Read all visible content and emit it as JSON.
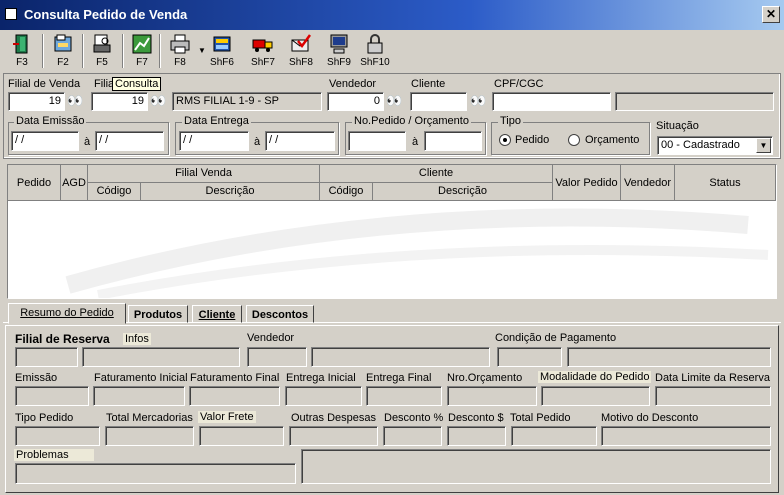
{
  "window": {
    "title": "Consulta Pedido de Venda",
    "close": "✕"
  },
  "toolbar": [
    {
      "name": "f3-exit-button",
      "label": "F3",
      "icon": "exit-icon"
    },
    {
      "name": "f2-button",
      "label": "F2",
      "icon": "folder-icon"
    },
    {
      "name": "f5-button",
      "label": "F5",
      "icon": "print-preview-icon"
    },
    {
      "name": "f7-button",
      "label": "F7",
      "icon": "chart-icon"
    },
    {
      "name": "f8-button",
      "label": "F8",
      "icon": "printer-icon"
    },
    {
      "name": "shf6-button",
      "label": "ShF6",
      "icon": "book-icon"
    },
    {
      "name": "shf7-button",
      "label": "ShF7",
      "icon": "truck-icon"
    },
    {
      "name": "shf8-button",
      "label": "ShF8",
      "icon": "check-mail-icon"
    },
    {
      "name": "shf9-button",
      "label": "ShF9",
      "icon": "monitor-icon"
    },
    {
      "name": "shf10-button",
      "label": "ShF10",
      "icon": "lock-icon"
    }
  ],
  "filter": {
    "filial_venda_label": "Filial de Venda",
    "filial_venda_value": "19",
    "filial_label": "Filia",
    "tooltip": "Consulta",
    "filial_value": "19",
    "filial_desc": "RMS FILIAL 1-9 - SP",
    "vendedor_label": "Vendedor",
    "vendedor_value": "0",
    "cliente_label": "Cliente",
    "cliente_value": "",
    "cpf_label": "CPF/CGC",
    "cpf_value": "",
    "data_emissao_label": "Data Emissão",
    "date_empty": "/ /",
    "a_label": "à",
    "data_entrega_label": "Data Entrega",
    "nopedido_label": "No.Pedido / Orçamento",
    "tipo_label": "Tipo",
    "tipo_pedido": "Pedido",
    "tipo_orcamento": "Orçamento",
    "situacao_label": "Situação",
    "situacao_value": "00 - Cadastrado"
  },
  "grid": {
    "pedido": "Pedido",
    "agd": "AGD",
    "filial_venda": "Filial Venda",
    "cliente": "Cliente",
    "codigo": "Código",
    "descricao": "Descrição",
    "valor_pedido": "Valor Pedido",
    "vendedor": "Vendedor",
    "status": "Status"
  },
  "tabs": [
    "Resumo do Pedido",
    "Produtos",
    "Cliente",
    "Descontos"
  ],
  "resumo": {
    "filial_reserva": "Filial de Reserva",
    "infos": "Infos",
    "vendedor": "Vendedor",
    "condicao": "Condição de Pagamento",
    "emissao": "Emissão",
    "fat_inicial": "Faturamento Inicial",
    "fat_final": "Faturamento Final",
    "ent_inicial": "Entrega Inicial",
    "ent_final": "Entrega Final",
    "nro_orc": "Nro.Orçamento",
    "modalidade": "Modalidade do Pedido",
    "data_limite": "Data Limite da Reserva",
    "tipo_pedido": "Tipo Pedido",
    "total_merc": "Total Mercadorias",
    "valor_frete": "Valor Frete",
    "outras": "Outras Despesas",
    "desc_pct": "Desconto %",
    "desc_val": "Desconto $",
    "total_pedido": "Total Pedido",
    "motivo": "Motivo do Desconto",
    "problemas": "Problemas"
  }
}
